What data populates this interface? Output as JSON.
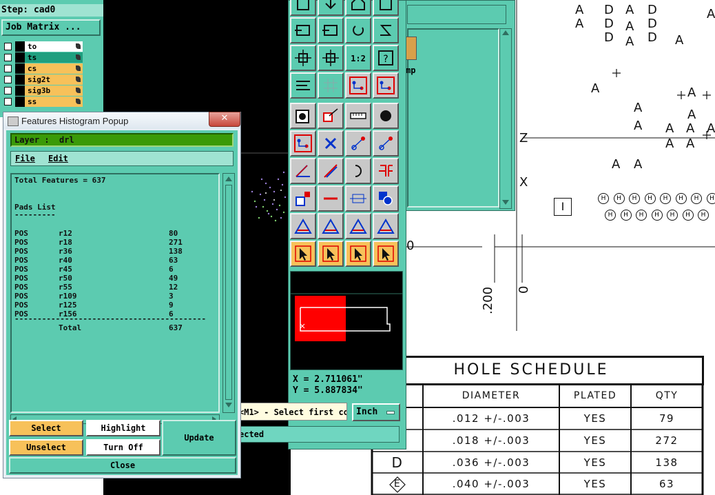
{
  "job_panel": {
    "step_label": "Step: cad0",
    "job_matrix_label": "Job Matrix ...",
    "layers": [
      {
        "name": "to",
        "bg": "#ffffff"
      },
      {
        "name": "ts",
        "bg": "#1f9f7f"
      },
      {
        "name": "cs",
        "bg": "#f7c15a"
      },
      {
        "name": "sig2t",
        "bg": "#f7c15a"
      },
      {
        "name": "sig3b",
        "bg": "#f7c15a"
      },
      {
        "name": "ss",
        "bg": "#f7c15a"
      }
    ]
  },
  "histogram_popup": {
    "title": "Features Histogram Popup",
    "close_glyph": "✕",
    "layer_label": "Layer :  drl",
    "menu": {
      "file": "File",
      "edit": "Edit"
    },
    "total_features": "Total Features = 637",
    "pads_list_title": "Pads List",
    "pads_underline": "---------",
    "rows": [
      {
        "pol": "POS",
        "sym": "r12",
        "count": "80"
      },
      {
        "pol": "POS",
        "sym": "r18",
        "count": "271"
      },
      {
        "pol": "POS",
        "sym": "r36",
        "count": "138"
      },
      {
        "pol": "POS",
        "sym": "r40",
        "count": "63"
      },
      {
        "pol": "POS",
        "sym": "r45",
        "count": "6"
      },
      {
        "pol": "POS",
        "sym": "r50",
        "count": "49"
      },
      {
        "pol": "POS",
        "sym": "r55",
        "count": "12"
      },
      {
        "pol": "POS",
        "sym": "r109",
        "count": "3"
      },
      {
        "pol": "POS",
        "sym": "r125",
        "count": "9"
      },
      {
        "pol": "POS",
        "sym": "r156",
        "count": "6"
      }
    ],
    "separator": "------------------------------------------",
    "total_label": "Total",
    "total_value": "637",
    "buttons": {
      "select": "Select",
      "highlight": "Highlight",
      "update": "Update",
      "unselect": "Unselect",
      "turn_off": "Turn Off",
      "close": "Close"
    }
  },
  "toolbar_panel": {
    "coords": {
      "x": "X = 2.711061\"",
      "y": "Y = 5.887834\""
    },
    "units_button": "Inch",
    "one_to_two_label": "1:2",
    "status_prompt": "<M1> - Select first co",
    "status_line": "ected"
  },
  "back_window": {
    "partial_label": "mp"
  },
  "drawing": {
    "dim_200": ".200",
    "dim_0": "0",
    "dim_left": "0",
    "box_label": "I",
    "hole_schedule": {
      "title": "HOLE SCHEDULE",
      "headers": [
        "DIAMETER",
        "PLATED",
        "QTY"
      ],
      "rows": [
        {
          "symbol": "",
          "diameter": ".012 +/-.003",
          "plated": "YES",
          "qty": "79"
        },
        {
          "symbol": "",
          "diameter": ".018 +/-.003",
          "plated": "YES",
          "qty": "272"
        },
        {
          "symbol": "D",
          "diameter": ".036 +/-.003",
          "plated": "YES",
          "qty": "138"
        },
        {
          "symbol": "E",
          "diameter": ".040 +/-.003",
          "plated": "YES",
          "qty": "63"
        }
      ]
    },
    "letters": {
      "a": "A",
      "d": "D",
      "h": "H",
      "z": "Z",
      "x": "X"
    }
  }
}
